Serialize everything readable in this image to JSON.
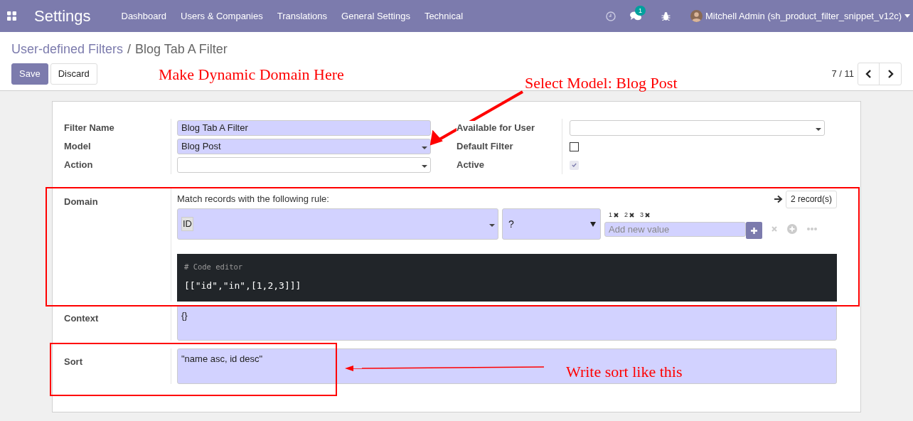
{
  "navbar": {
    "app_title": "Settings",
    "menu": [
      "Dashboard",
      "Users & Companies",
      "Translations",
      "General Settings",
      "Technical"
    ],
    "chat_badge": "1",
    "user": "Mitchell Admin (sh_product_filter_snippet_v12c)"
  },
  "breadcrumb": {
    "parent": "User-defined Filters",
    "separator": "/",
    "current": "Blog Tab A Filter"
  },
  "buttons": [
    "Save",
    "Discard"
  ],
  "pager": "7 / 11",
  "form": {
    "left": [
      {
        "label": "Filter Name",
        "kind": "text",
        "required": true,
        "value": "Blog Tab A Filter"
      },
      {
        "label": "Model",
        "kind": "select",
        "required": true,
        "value": "Blog Post"
      },
      {
        "label": "Action",
        "kind": "select",
        "required": false
      }
    ],
    "right": [
      {
        "label": "Available for User",
        "kind": "select",
        "required": false
      },
      {
        "label": "Default Filter",
        "kind": "checkbox",
        "checked": false,
        "disabled": false
      },
      {
        "label": "Active",
        "kind": "checkbox",
        "checked": true,
        "disabled": true
      }
    ],
    "domain": {
      "label": "Domain",
      "intro": "Match records with the following rule:",
      "record_count": "2 record(s)",
      "field": "ID",
      "operator": "?",
      "tags": [
        "1",
        "2",
        "3"
      ],
      "placeholder": "Add new value",
      "code_comment": "# Code editor",
      "code": "[[\"id\",\"in\",[1,2,3]]]"
    },
    "context": {
      "label": "Context",
      "value": "{}"
    },
    "sort": {
      "label": "Sort",
      "value": "\"name asc, id desc\""
    }
  },
  "annotations": [
    {
      "kind": "text",
      "text": "Make Dynamic Domain Here"
    },
    {
      "kind": "text",
      "text": "Select Model: Blog Post"
    },
    {
      "kind": "text",
      "text": "Write sort like this"
    }
  ]
}
